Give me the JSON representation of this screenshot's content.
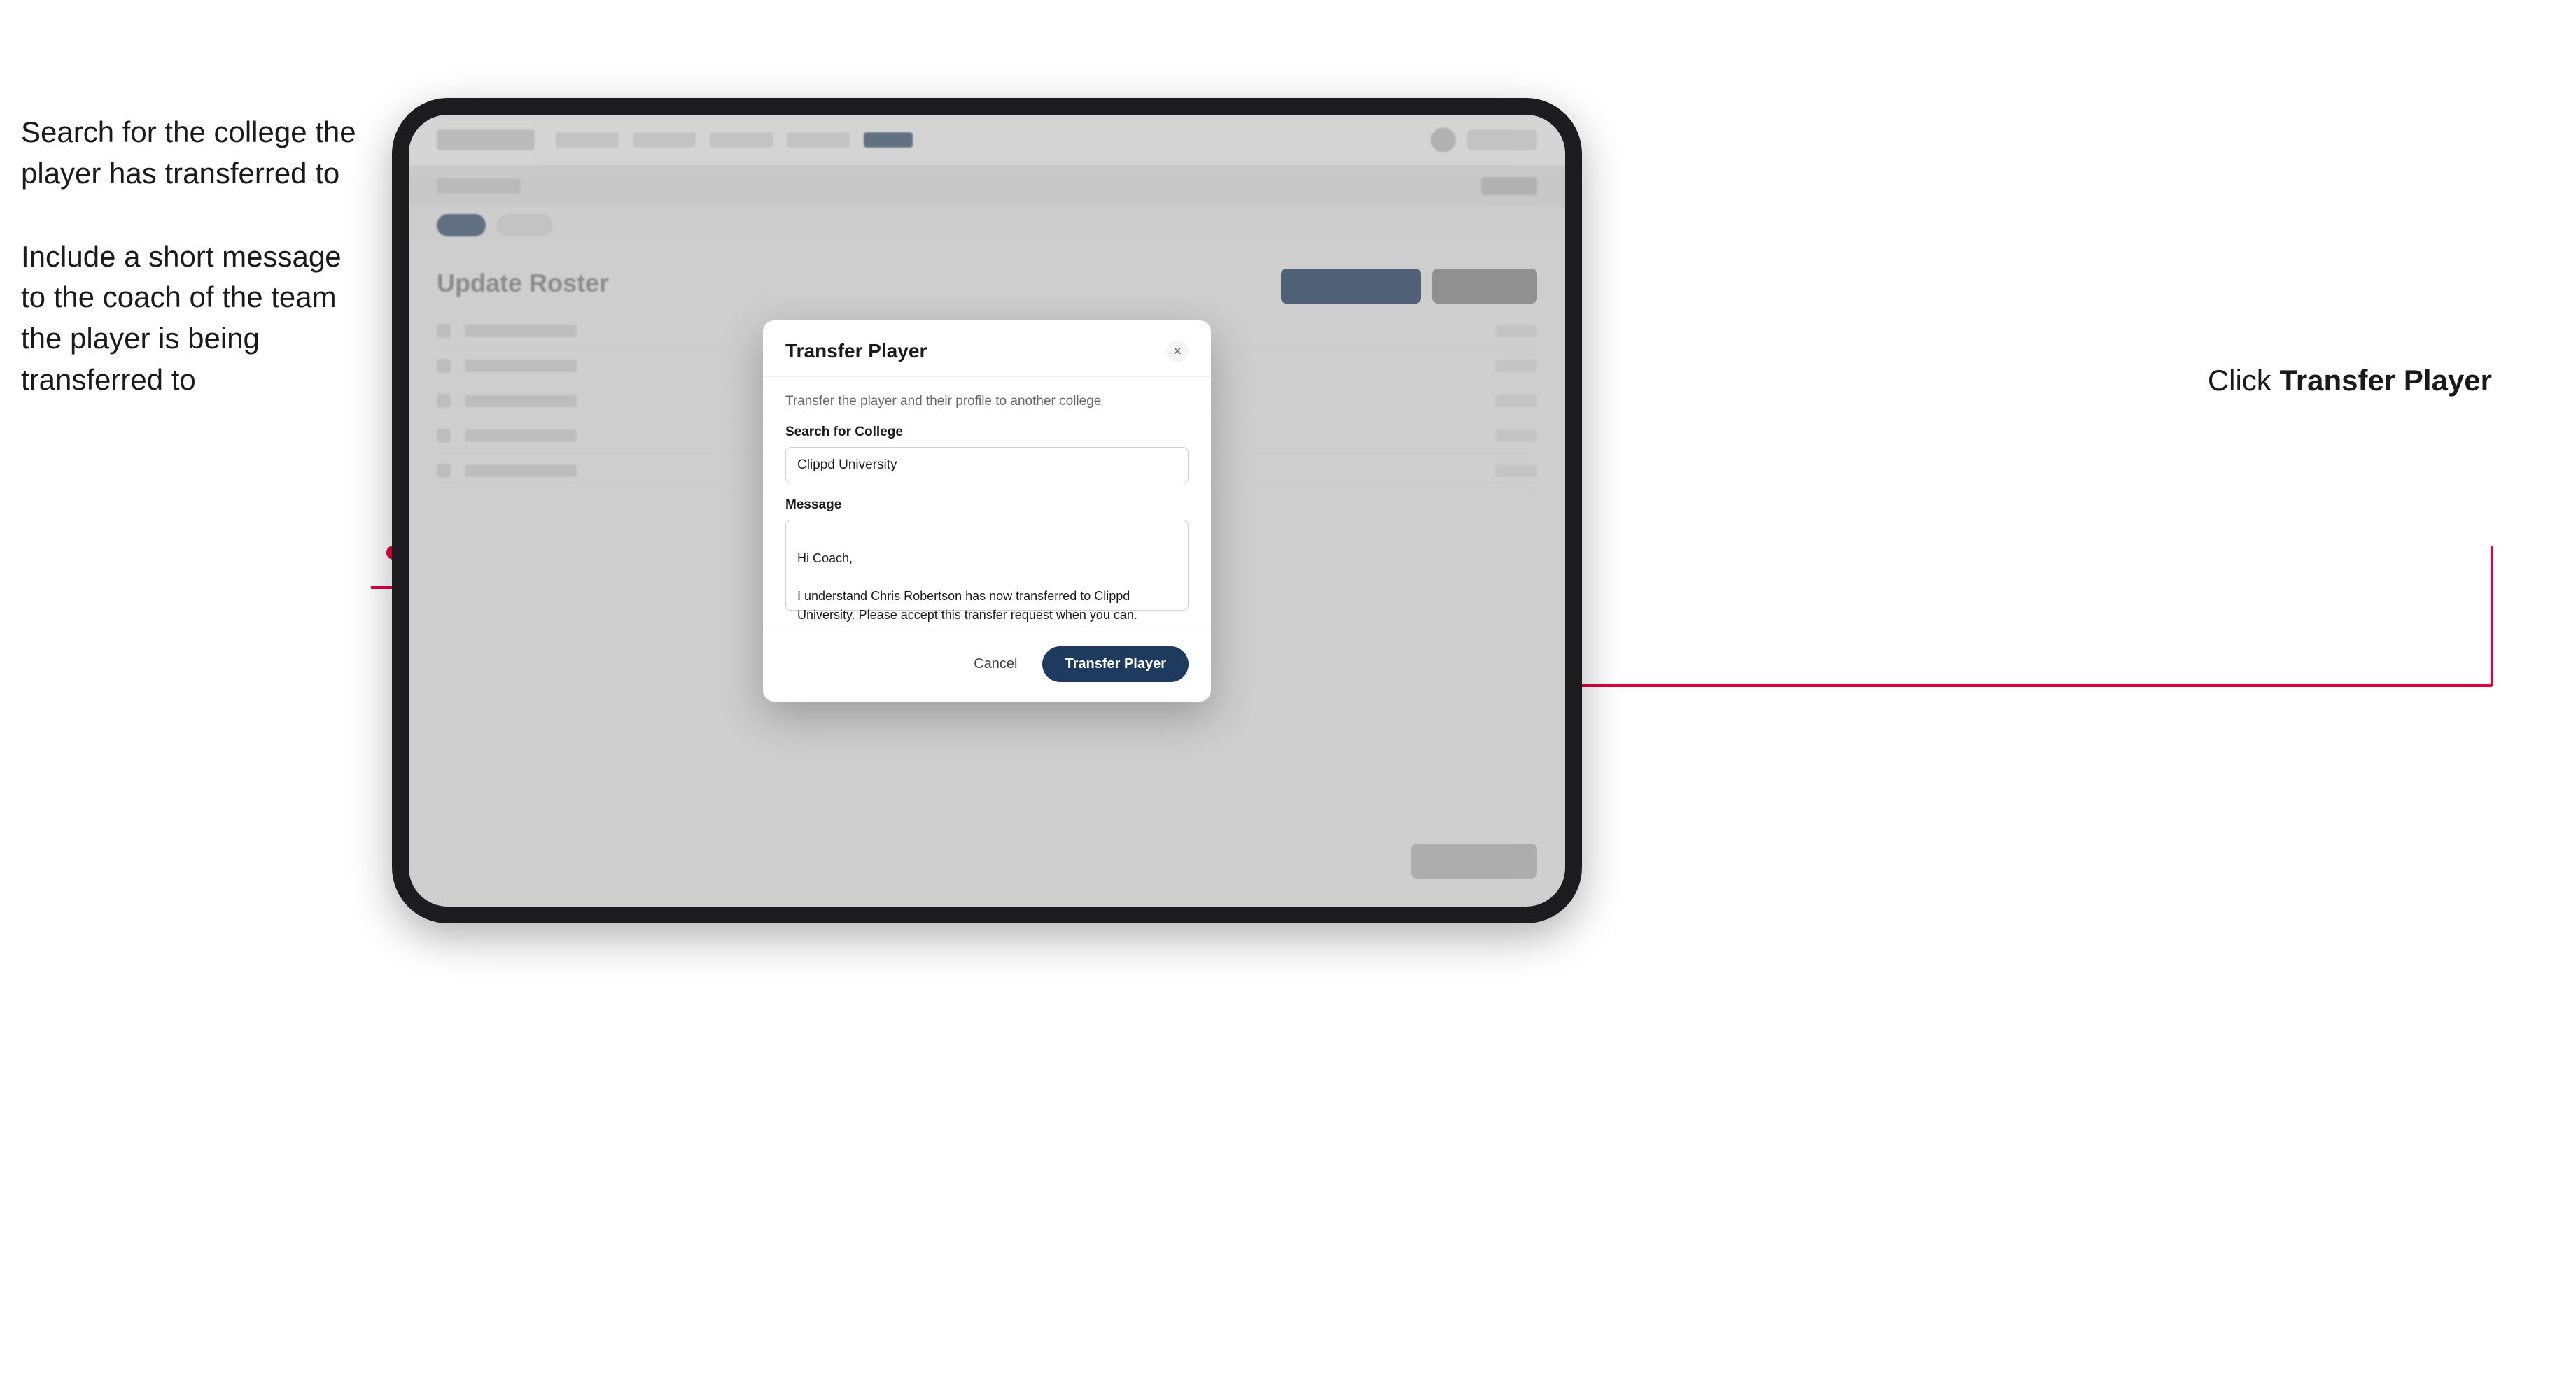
{
  "annotations": {
    "left_top": "Search for the college the player has transferred to",
    "left_bottom": "Include a short message to the coach of the team the player is being transferred to",
    "right": "Click ",
    "right_bold": "Transfer Player"
  },
  "tablet": {
    "navbar": {
      "logo_alt": "logo"
    },
    "page_title": "Update Roster"
  },
  "modal": {
    "title": "Transfer Player",
    "description": "Transfer the player and their profile to another college",
    "search_label": "Search for College",
    "search_value": "Clippd University",
    "message_label": "Message",
    "message_value": "Hi Coach,\n\nI understand Chris Robertson has now transferred to Clippd University. Please accept this transfer request when you can.",
    "cancel_label": "Cancel",
    "transfer_label": "Transfer Player",
    "close_icon": "×"
  }
}
